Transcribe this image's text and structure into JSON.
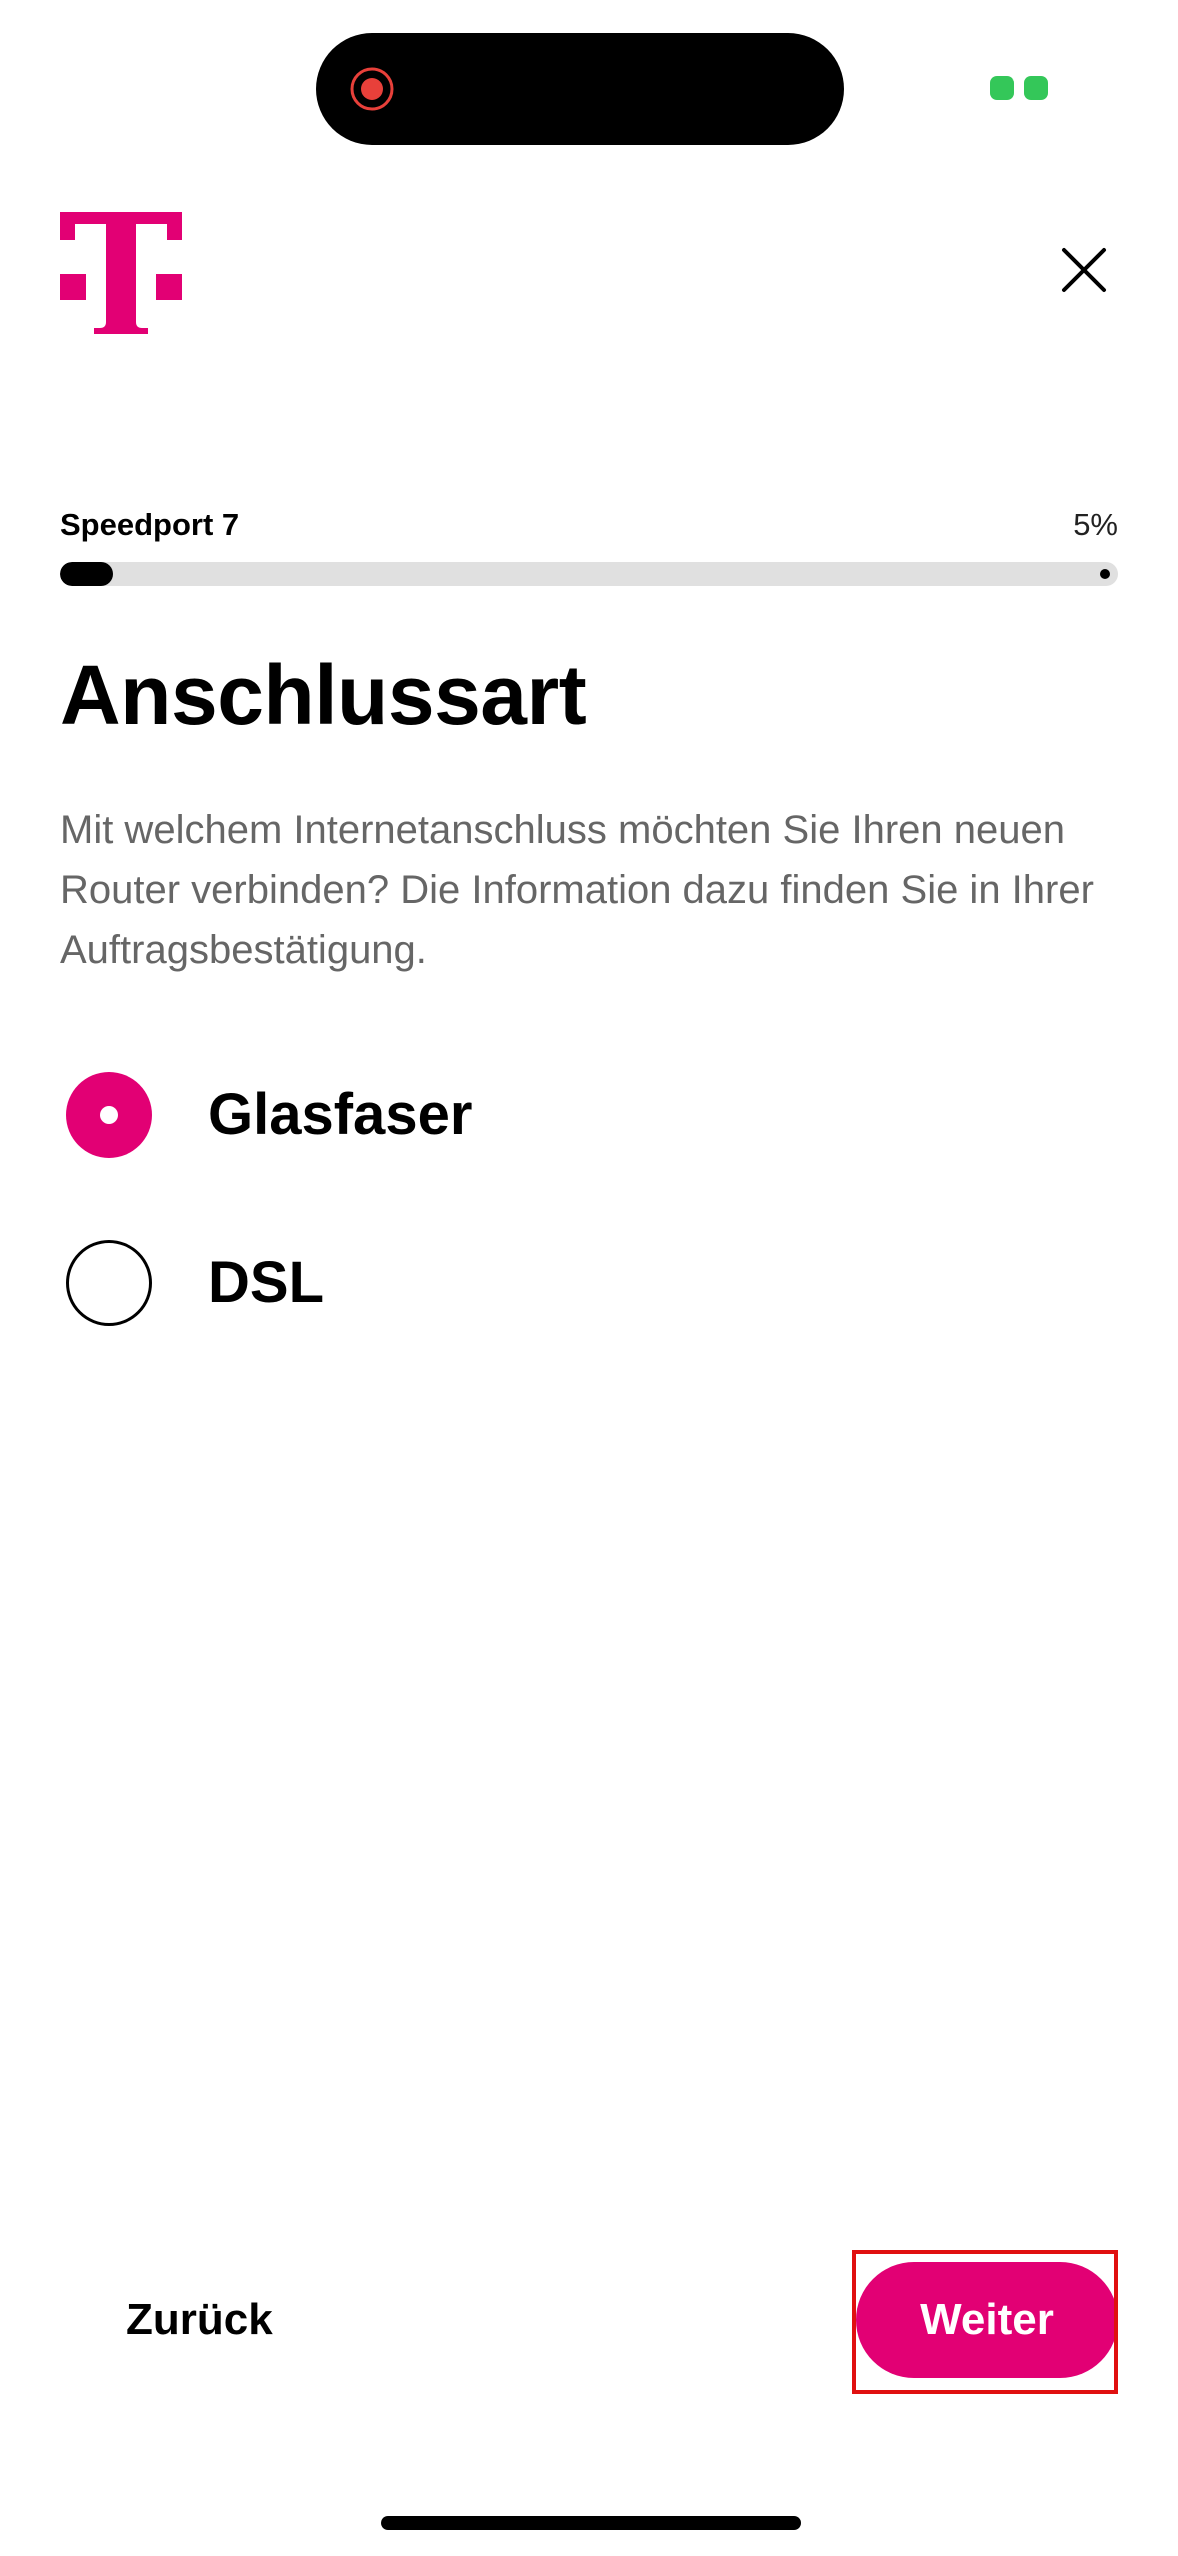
{
  "status_bar": {
    "recording_icon": "screen-recording-icon",
    "battery_icon": "battery-charging-icon",
    "battery_color": "#34c759"
  },
  "header": {
    "logo_icon": "telekom-t-logo",
    "close_icon": "close-icon"
  },
  "progress": {
    "label": "Speedport 7",
    "percent_text": "5%",
    "value": 0.05
  },
  "content": {
    "title": "Anschlussart",
    "description": "Mit welchem Internetanschluss möchten Sie Ihren neuen Router verbinden? Die Information dazu finden Sie in Ihrer Auftragsbestätigung.",
    "options": [
      {
        "label": "Glasfaser",
        "selected": true
      },
      {
        "label": "DSL",
        "selected": false
      }
    ]
  },
  "footer": {
    "back_label": "Zurück",
    "next_label": "Weiter"
  },
  "colors": {
    "brand_magenta": "#e20074",
    "highlight_red": "#e01010"
  }
}
